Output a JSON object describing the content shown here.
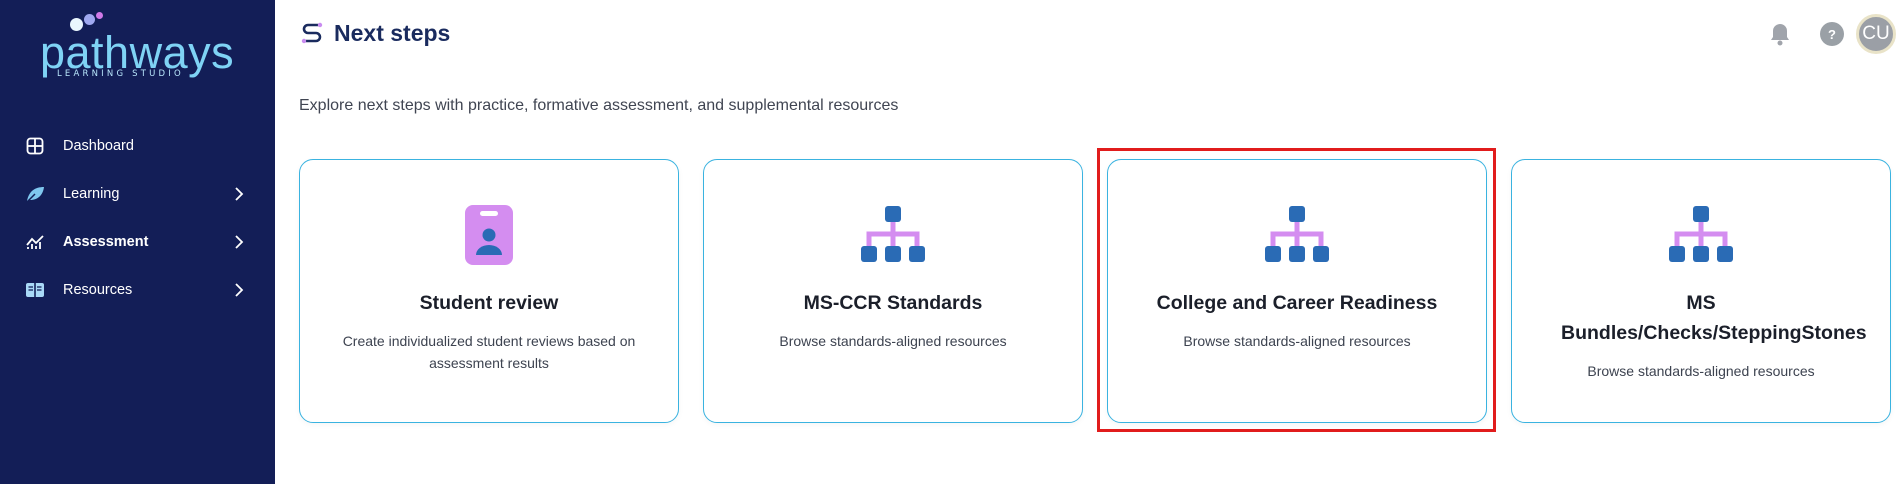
{
  "sidebar": {
    "logo_text": "pathways",
    "logo_subtext": "LEARNING STUDIO",
    "items": [
      {
        "label": "Dashboard",
        "icon": "dashboard-grid-icon",
        "has_chevron": false
      },
      {
        "label": "Learning",
        "icon": "leaf-icon",
        "has_chevron": true
      },
      {
        "label": "Assessment",
        "icon": "chart-line-icon",
        "has_chevron": true,
        "active": true
      },
      {
        "label": "Resources",
        "icon": "book-icon",
        "has_chevron": true
      }
    ]
  },
  "header": {
    "title": "Next steps",
    "title_icon": "path-steps-icon",
    "notifications_icon": "bell-icon",
    "help_label": "?",
    "avatar_initials": "CU"
  },
  "main": {
    "subtitle": "Explore next steps with practice, formative assessment, and supplemental resources",
    "cards": [
      {
        "title": "Student review",
        "description": "Create individualized student reviews based on assessment results",
        "icon": "id-badge-icon"
      },
      {
        "title": "MS-CCR Standards",
        "description": "Browse standards-aligned resources",
        "icon": "hierarchy-icon"
      },
      {
        "title": "College and Career Readiness",
        "description": "Browse standards-aligned resources",
        "icon": "hierarchy-icon",
        "highlighted": true
      },
      {
        "title": "MS Bundles/Checks/SteppingStones",
        "description": "Browse standards-aligned resources",
        "icon": "hierarchy-icon"
      }
    ]
  },
  "colors": {
    "sidebar_bg": "#131e57",
    "card_border": "#3ab3e0",
    "icon_purple": "#c98cf0",
    "icon_blue": "#2a6bb5",
    "highlight_red": "#e11c1c"
  }
}
